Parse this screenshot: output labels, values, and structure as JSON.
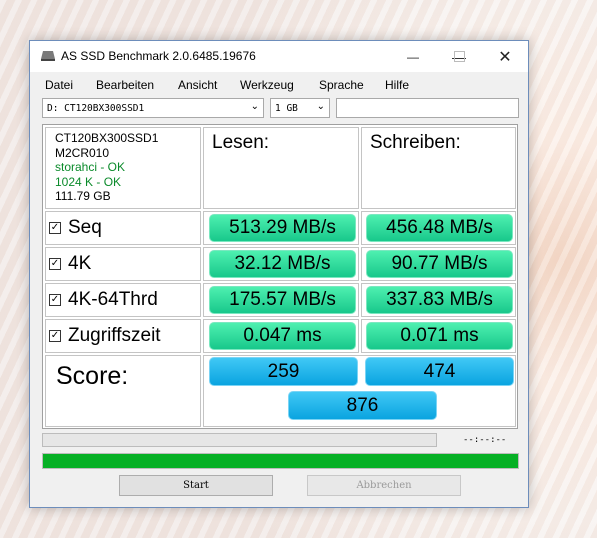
{
  "window": {
    "title": "AS SSD Benchmark 2.0.6485.19676",
    "minimize_icon": "minimize-icon",
    "maximize_icon": "maximize-icon",
    "close_icon": "close-icon"
  },
  "menu": [
    "Datei",
    "Bearbeiten",
    "Ansicht",
    "Werkzeug",
    "Sprache",
    "Hilfe"
  ],
  "drive_select": {
    "value": "D: CT120BX300SSD1"
  },
  "size_select": {
    "value": "1 GB"
  },
  "drive_info": {
    "model": "CT120BX300SSD1",
    "firmware": "M2CR010",
    "driver": "storahci - OK",
    "alignment": "1024 K - OK",
    "capacity": "111.79 GB"
  },
  "columns": {
    "read": "Lesen:",
    "write": "Schreiben:"
  },
  "rows": [
    {
      "label": "Seq",
      "checked": true,
      "read": "513.29 MB/s",
      "write": "456.48 MB/s"
    },
    {
      "label": "4K",
      "checked": true,
      "read": "32.12 MB/s",
      "write": "90.77 MB/s"
    },
    {
      "label": "4K-64Thrd",
      "checked": true,
      "read": "175.57 MB/s",
      "write": "337.83 MB/s"
    },
    {
      "label": "Zugriffszeit",
      "checked": true,
      "read": "0.047 ms",
      "write": "0.071 ms"
    }
  ],
  "score": {
    "label": "Score:",
    "read": "259",
    "write": "474",
    "total": "876"
  },
  "progress": {
    "time": "--:--:--",
    "fraction": 1.0
  },
  "buttons": {
    "start": "Start",
    "abort": "Abbrechen"
  },
  "colors": {
    "result_green": "#18c88b",
    "score_blue": "#0aa4e0",
    "progress_green": "#06b025",
    "ok_green": "#0a8a2a"
  }
}
